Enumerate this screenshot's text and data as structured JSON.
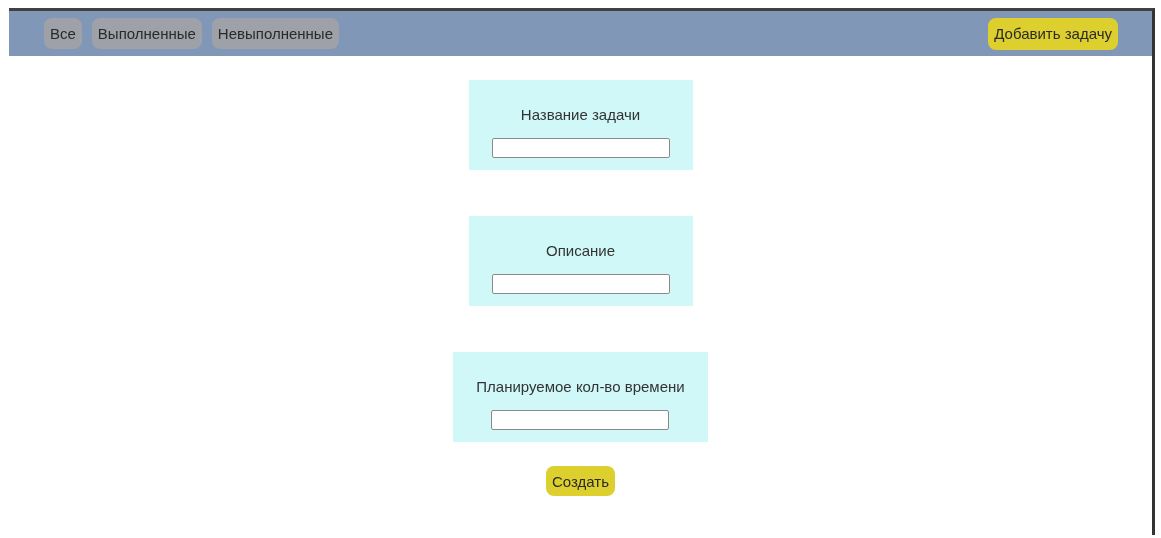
{
  "nav": {
    "filters": [
      "Все",
      "Выполненные",
      "Невыполненные"
    ],
    "add_button": "Добавить задачу"
  },
  "form": {
    "fields": [
      {
        "label": "Название задачи"
      },
      {
        "label": "Описание"
      },
      {
        "label": "Планируемое кол-во времени"
      }
    ],
    "submit": "Создать"
  }
}
